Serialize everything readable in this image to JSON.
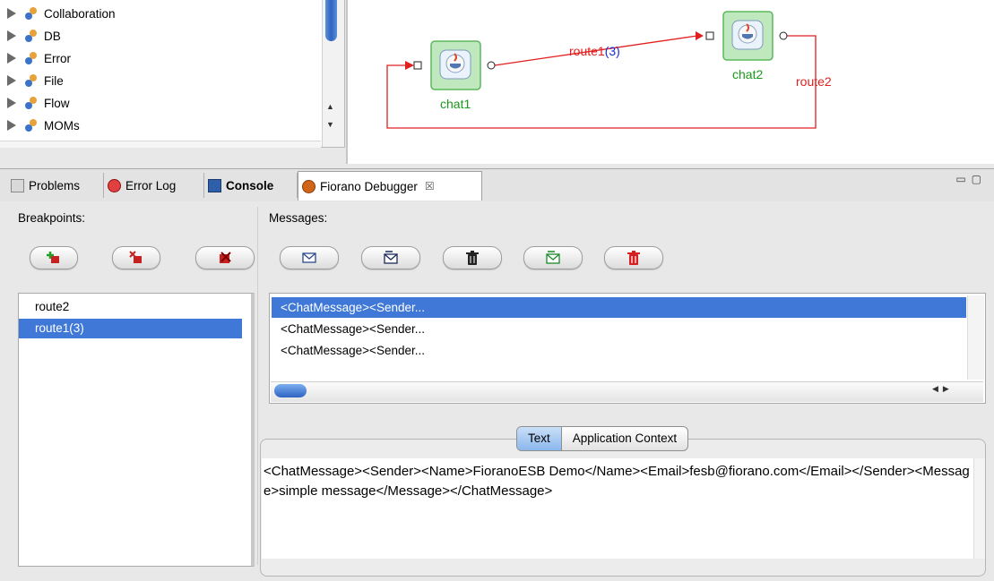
{
  "palette": {
    "items": [
      {
        "label": "Collaboration"
      },
      {
        "label": "DB"
      },
      {
        "label": "Error"
      },
      {
        "label": "File"
      },
      {
        "label": "Flow"
      },
      {
        "label": "MOMs"
      }
    ]
  },
  "canvas": {
    "nodes": [
      {
        "label": "chat1"
      },
      {
        "label": "chat2"
      }
    ],
    "routes": [
      {
        "name": "route1",
        "count": "(3)"
      },
      {
        "name": "route2"
      }
    ],
    "colors": {
      "route": "#e02020",
      "node_label": "#1a9a1a",
      "count": "#1a2ad8",
      "node_fill": "#bfe8bf",
      "node_border": "#5cb85c"
    }
  },
  "tabs": [
    {
      "label": "Problems",
      "icon": "problems-icon"
    },
    {
      "label": "Error Log",
      "icon": "error-log-icon"
    },
    {
      "label": "Console",
      "icon": "console-icon"
    },
    {
      "label": "Fiorano Debugger",
      "icon": "debugger-icon",
      "active": true,
      "close": "☒"
    }
  ],
  "breakpoints": {
    "label": "Breakpoints:",
    "buttons": [
      "add-breakpoint-icon",
      "remove-breakpoint-icon",
      "remove-all-breakpoints-icon"
    ],
    "items": [
      {
        "label": "route2"
      },
      {
        "label": "route1(3)",
        "selected": true
      }
    ]
  },
  "messages": {
    "label": "Messages:",
    "buttons": [
      "view-message-icon",
      "edit-message-icon",
      "delete-message-icon",
      "send-message-icon",
      "delete-all-messages-icon"
    ],
    "items": [
      {
        "label": "<ChatMessage><Sender...",
        "selected": true
      },
      {
        "label": "<ChatMessage><Sender..."
      },
      {
        "label": "<ChatMessage><Sender..."
      }
    ]
  },
  "detail": {
    "tabs": [
      {
        "label": "Text",
        "active": true
      },
      {
        "label": "Application Context"
      }
    ],
    "text": "<ChatMessage><Sender><Name>FioranoESB Demo</Name><Email>fesb@fiorano.com</Email></Sender><Message>simple message</Message></ChatMessage>"
  }
}
